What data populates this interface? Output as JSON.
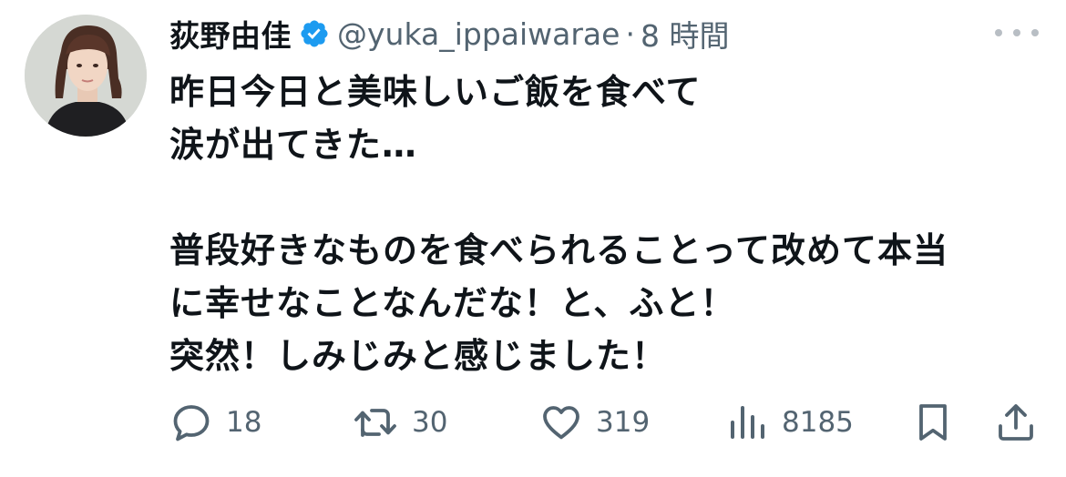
{
  "author": {
    "display_name": "荻野由佳",
    "handle": "@yuka_ippaiwarae",
    "separator": "·",
    "time": "8 時間",
    "verified": true,
    "verified_color": "#1d9bf0"
  },
  "tweet": {
    "lines": [
      "昨日今日と美味しいご飯を食べて",
      "涙が出てきた…",
      "",
      "普段好きなものを食べられることって改めて本当",
      "に幸せなことなんだな！と、ふと！",
      "突然！しみじみと感じました！"
    ]
  },
  "actions": {
    "reply_count": "18",
    "retweet_count": "30",
    "like_count": "319",
    "views_count": "8185"
  },
  "icons": {
    "more": "more-horizontal-icon",
    "reply": "reply-icon",
    "retweet": "retweet-icon",
    "like": "heart-icon",
    "views": "views-icon",
    "bookmark": "bookmark-icon",
    "share": "share-icon"
  },
  "colors": {
    "text_primary": "#0f1419",
    "text_secondary": "#536471",
    "icon": "#536471"
  }
}
